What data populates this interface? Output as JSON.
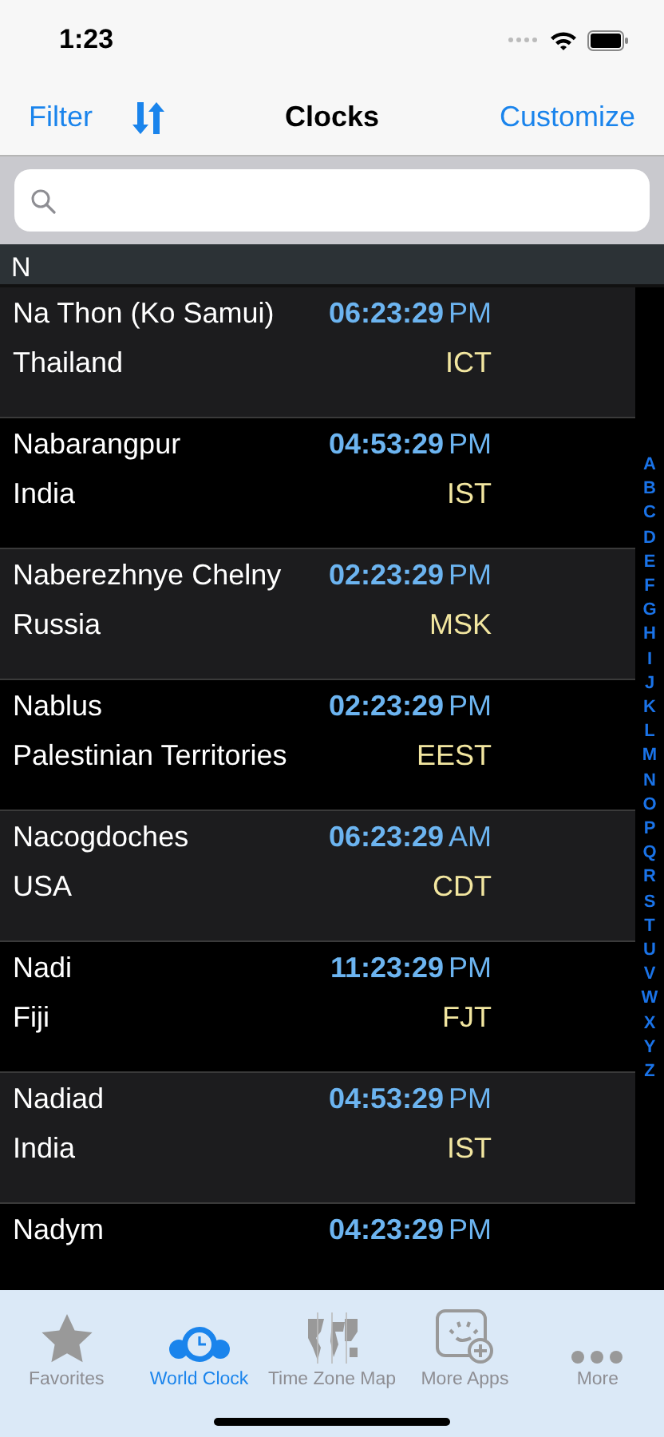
{
  "status_bar": {
    "time": "1:23"
  },
  "nav": {
    "left": "Filter",
    "title": "Clocks",
    "right": "Customize"
  },
  "section": "N",
  "rows": [
    {
      "city": "Na Thon (Ko Samui)",
      "time": "06:23:29",
      "ampm": "PM",
      "country": "Thailand",
      "zone": "ICT"
    },
    {
      "city": "Nabarangpur",
      "time": "04:53:29",
      "ampm": "PM",
      "country": "India",
      "zone": "IST"
    },
    {
      "city": "Naberezhnye Chelny",
      "time": "02:23:29",
      "ampm": "PM",
      "country": "Russia",
      "zone": "MSK"
    },
    {
      "city": "Nablus",
      "time": "02:23:29",
      "ampm": "PM",
      "country": "Palestinian Territories",
      "zone": "EEST"
    },
    {
      "city": "Nacogdoches",
      "time": "06:23:29",
      "ampm": "AM",
      "country": "USA",
      "zone": "CDT"
    },
    {
      "city": "Nadi",
      "time": "11:23:29",
      "ampm": "PM",
      "country": "Fiji",
      "zone": "FJT"
    },
    {
      "city": "Nadiad",
      "time": "04:53:29",
      "ampm": "PM",
      "country": "India",
      "zone": "IST"
    },
    {
      "city": "Nadym",
      "time": "04:23:29",
      "ampm": "PM"
    }
  ],
  "index": [
    "A",
    "B",
    "C",
    "D",
    "E",
    "F",
    "G",
    "H",
    "I",
    "J",
    "K",
    "L",
    "M",
    "N",
    "O",
    "P",
    "Q",
    "R",
    "S",
    "T",
    "U",
    "V",
    "W",
    "X",
    "Y",
    "Z"
  ],
  "tabs": [
    {
      "label": "Favorites",
      "kind": "star",
      "selected": false
    },
    {
      "label": "World Clock",
      "kind": "clock",
      "selected": true
    },
    {
      "label": "Time Zone Map",
      "kind": "map",
      "selected": false
    },
    {
      "label": "More Apps",
      "kind": "apps",
      "selected": false
    },
    {
      "label": "More",
      "kind": "more",
      "selected": false
    }
  ]
}
